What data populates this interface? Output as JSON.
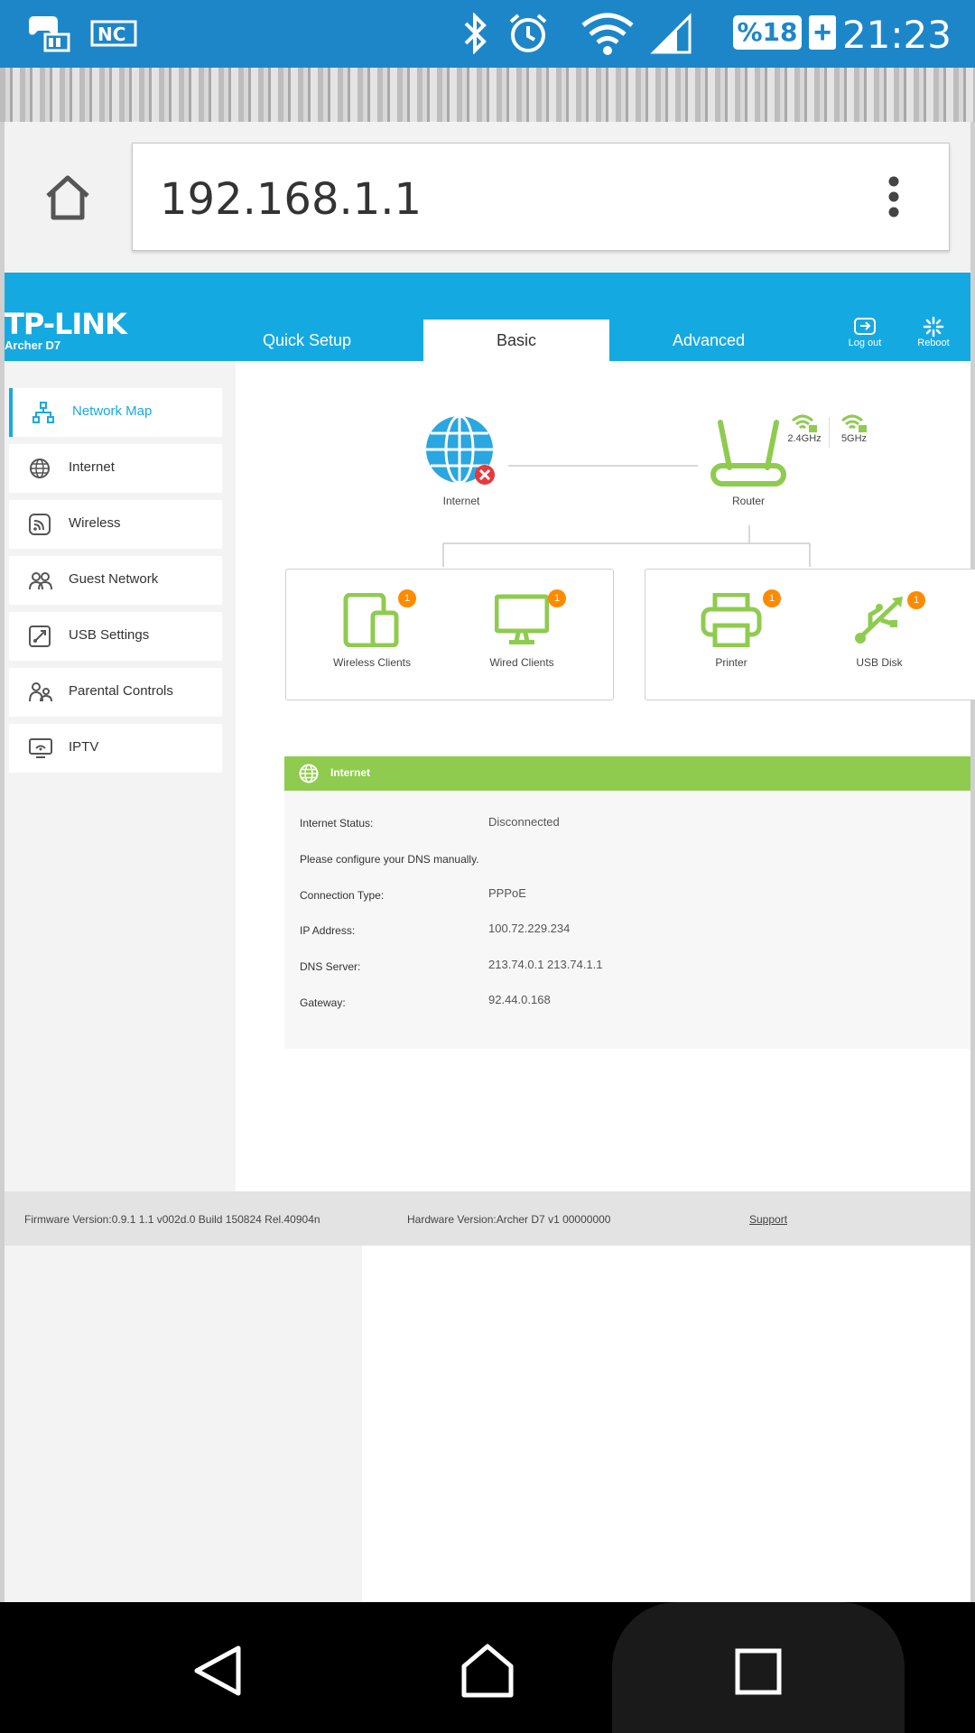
{
  "status_bar": {
    "time": "21:23",
    "battery": "%18",
    "battery_plus": "+",
    "icons": [
      "game-controller-icon",
      "nfc-icon",
      "bluetooth-icon",
      "alarm-icon",
      "wifi-icon",
      "cell-signal-icon",
      "battery-icon"
    ]
  },
  "browser": {
    "url": "192.168.1.1",
    "home_icon": "home-icon",
    "menu_icon": "more-vert-icon"
  },
  "router": {
    "brand": "TP-LINK",
    "model": "Archer D7",
    "tabs": [
      {
        "label": "Quick Setup"
      },
      {
        "label": "Basic"
      },
      {
        "label": "Advanced"
      }
    ],
    "actions": {
      "logout": "Log out",
      "reboot": "Reboot"
    },
    "sidebar": [
      {
        "label": "Network Map",
        "icon": "network-map-icon"
      },
      {
        "label": "Internet",
        "icon": "globe-icon"
      },
      {
        "label": "Wireless",
        "icon": "wireless-icon"
      },
      {
        "label": "Guest Network",
        "icon": "guest-network-icon"
      },
      {
        "label": "USB Settings",
        "icon": "usb-settings-icon"
      },
      {
        "label": "Parental Controls",
        "icon": "parental-controls-icon"
      },
      {
        "label": "IPTV",
        "icon": "iptv-icon"
      }
    ],
    "map": {
      "internet_label": "Internet",
      "router_label": "Router",
      "band_24": "2.4GHz",
      "band_5": "5GHz",
      "devices": [
        {
          "label": "Wireless Clients",
          "count": "1"
        },
        {
          "label": "Wired Clients",
          "count": "1"
        },
        {
          "label": "Printer",
          "count": "1"
        },
        {
          "label": "USB Disk",
          "count": "1"
        }
      ]
    },
    "internet_panel": {
      "title": "Internet",
      "status_label": "Internet Status:",
      "status_value": "Disconnected",
      "dns_note": "Please configure your DNS manually.",
      "conn_label": "Connection Type:",
      "conn_value": "PPPoE",
      "ip_label": "IP Address:",
      "ip_value": "100.72.229.234",
      "dns_label": "DNS Server:",
      "dns_value": "213.74.0.1 213.74.1.1",
      "gw_label": "Gateway:",
      "gw_value": "92.44.0.168"
    },
    "footer": {
      "firmware": "Firmware Version:0.9.1 1.1 v002d.0 Build 150824 Rel.40904n",
      "hardware": "Hardware Version:Archer D7 v1 00000000",
      "support": "Support"
    },
    "colors": {
      "header_blue": "#15a9e2",
      "green": "#8fcb4f",
      "badge_orange": "#ff8a00"
    }
  },
  "navbar": {
    "back_icon": "back-icon",
    "home_icon": "home-icon",
    "recents_icon": "recents-icon"
  }
}
